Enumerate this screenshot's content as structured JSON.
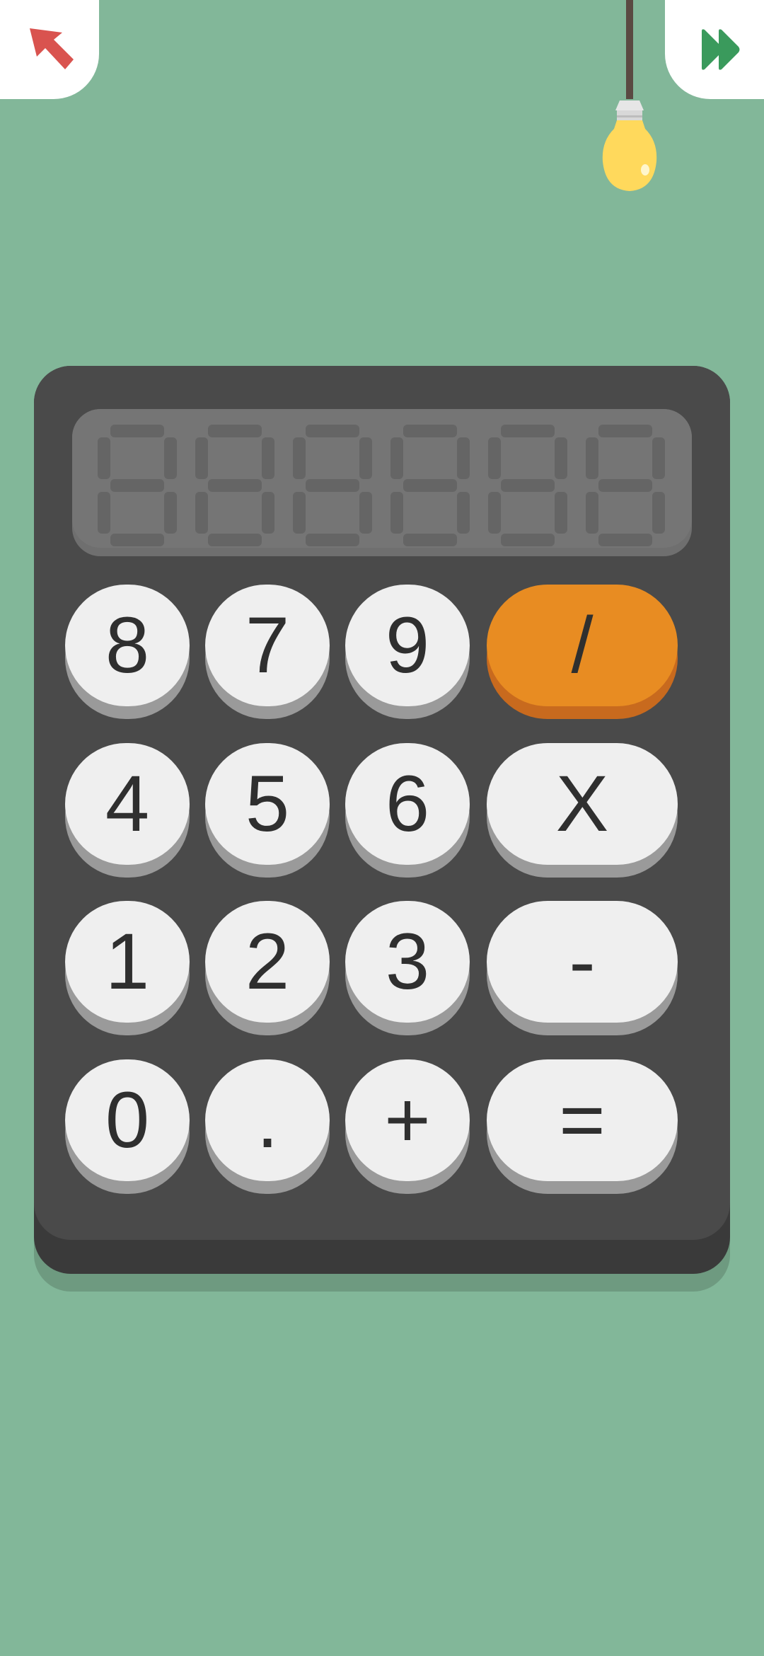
{
  "nav": {
    "back_icon": "arrow-up-left-icon",
    "skip_icon": "fast-forward-icon",
    "hint_icon": "light-bulb-icon"
  },
  "display": {
    "digits_shown": 6,
    "state": "blank"
  },
  "keypad": {
    "rows": [
      [
        "8",
        "7",
        "9",
        "/"
      ],
      [
        "4",
        "5",
        "6",
        "X"
      ],
      [
        "1",
        "2",
        "3",
        "-"
      ],
      [
        "0",
        ".",
        "+",
        "="
      ]
    ]
  },
  "colors": {
    "background": "#82b799",
    "calculator": "#4a4a4a",
    "key": "#efefef",
    "accent_key": "#e88c22",
    "back_arrow": "#d9534f",
    "skip_arrow": "#3a9a5c",
    "bulb": "#ffd95c"
  }
}
